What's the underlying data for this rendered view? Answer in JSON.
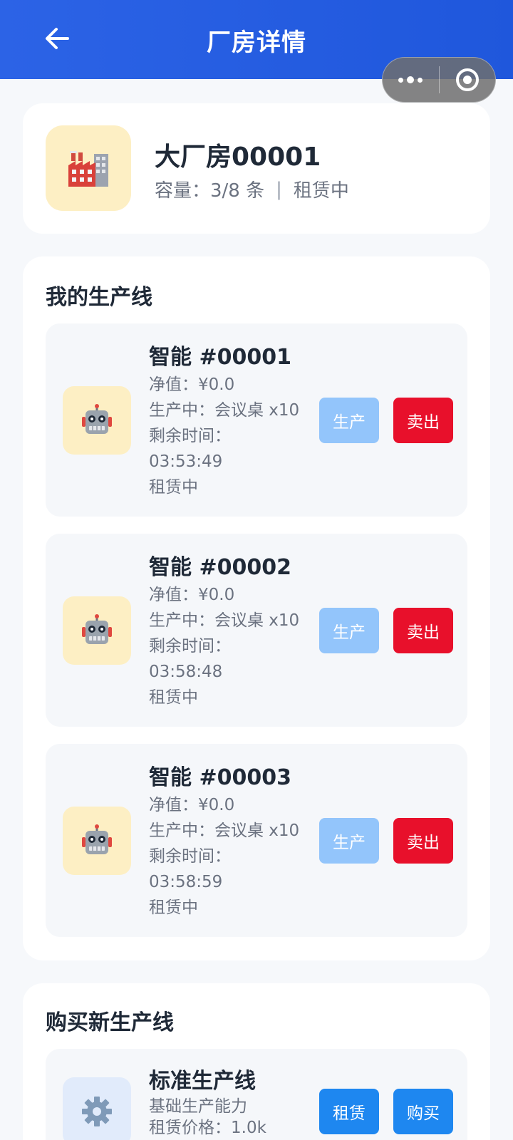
{
  "header": {
    "title": "厂房详情"
  },
  "factory": {
    "name": "大厂房00001",
    "capacity": "容量：3/8 条",
    "separator": "|",
    "status": "租赁中"
  },
  "my_lines": {
    "title": "我的生产线",
    "produce_label": "生产",
    "sell_label": "卖出",
    "items": [
      {
        "name": "智能 #00001",
        "net_value": "净值：¥0.0",
        "producing": "生产中：会议桌 x10",
        "remaining_label": "剩余时间：",
        "remaining_time": "03:53:49",
        "status": "租赁中"
      },
      {
        "name": "智能 #00002",
        "net_value": "净值：¥0.0",
        "producing": "生产中：会议桌 x10",
        "remaining_label": "剩余时间：",
        "remaining_time": "03:58:48",
        "status": "租赁中"
      },
      {
        "name": "智能 #00003",
        "net_value": "净值：¥0.0",
        "producing": "生产中：会议桌 x10",
        "remaining_label": "剩余时间：",
        "remaining_time": "03:58:59",
        "status": "租赁中"
      }
    ]
  },
  "buy_lines": {
    "title": "购买新生产线",
    "items": [
      {
        "name": "标准生产线",
        "description": "基础生产能力",
        "rent_price": "租赁价格：1.0k",
        "rent_label": "租赁",
        "buy_label": "购买"
      }
    ]
  },
  "icons": {
    "back": "arrow-left-icon",
    "more": "more-dots-icon",
    "close": "target-circle-icon",
    "factory": "factory-icon",
    "robot": "robot-icon",
    "gear": "gear-icon"
  },
  "colors": {
    "header": "#2c63e6",
    "produce_button": "#93c5fb",
    "sell_button": "#e8102b",
    "action_button": "#1e87f0",
    "icon_bg_yellow": "#fdefc4",
    "icon_bg_blue": "#e1ebfb"
  }
}
